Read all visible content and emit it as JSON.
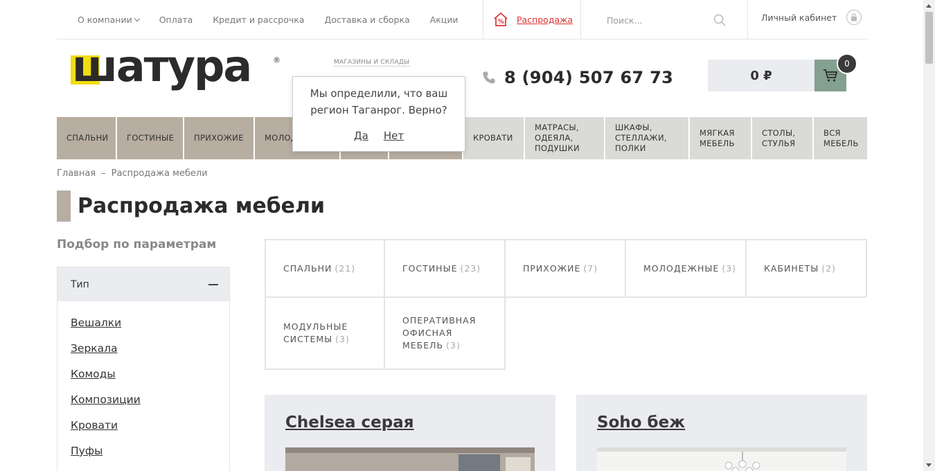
{
  "topnav": {
    "items": [
      "О компании",
      "Оплата",
      "Кредит и рассрочка",
      "Доставка и сборка",
      "Акции"
    ],
    "sale_label": "Распродажа",
    "search_placeholder": "Поиск...",
    "cabinet_label": "Личный кабинет"
  },
  "header": {
    "logo_text": "шатура",
    "logo_reg": "®",
    "stores_label": "магазины и склады",
    "phone": "8 (904) 507 67 73",
    "cart_sum": "0 ₽",
    "cart_count": "0"
  },
  "mainnav": [
    {
      "label": "Спальни"
    },
    {
      "label": "Гостиные"
    },
    {
      "label": "Прихожие"
    },
    {
      "label": "Молод"
    },
    {
      "label": ""
    },
    {
      "label": ""
    },
    {
      "label": "Кровати"
    },
    {
      "label": "Матрасы, одеяла, подушки"
    },
    {
      "label": "Шкафы, стеллажи, полки"
    },
    {
      "label": "Мягкая мебель"
    },
    {
      "label": "Столы, стулья"
    },
    {
      "label": "Вся мебель"
    }
  ],
  "popup": {
    "question": "Мы определили, что ваш регион Таганрог. Верно?",
    "yes": "Да",
    "no": "Нет"
  },
  "breadcrumb": {
    "home": "Главная",
    "sep": "–",
    "current": "Распродажа мебели"
  },
  "page_title": "Распродажа мебели",
  "filter": {
    "heading": "Подбор по параметрам",
    "section": "Тип",
    "items": [
      "Вешалки",
      "Зеркала",
      "Комоды",
      "Композиции",
      "Кровати",
      "Пуфы"
    ]
  },
  "categories": [
    {
      "label": "Спальни",
      "count": "(21)"
    },
    {
      "label": "Гостиные",
      "count": "(23)"
    },
    {
      "label": "Прихожие",
      "count": "(7)"
    },
    {
      "label": "Молодежные",
      "count": "(3)"
    },
    {
      "label": "Кабинеты",
      "count": "(2)"
    },
    {
      "label": "Модульные системы",
      "count": "(3)"
    },
    {
      "label": "Оперативная офисная мебель",
      "count": "(3)"
    }
  ],
  "products": [
    {
      "name": "Chelsea серая"
    },
    {
      "name": "Soho беж"
    }
  ],
  "colors": {
    "accent": "#b8ada1",
    "nav_light": "#dadad6",
    "cart_btn": "#84a08f",
    "logo_yellow": "#f2dd10",
    "sale_red": "#dd3333"
  }
}
